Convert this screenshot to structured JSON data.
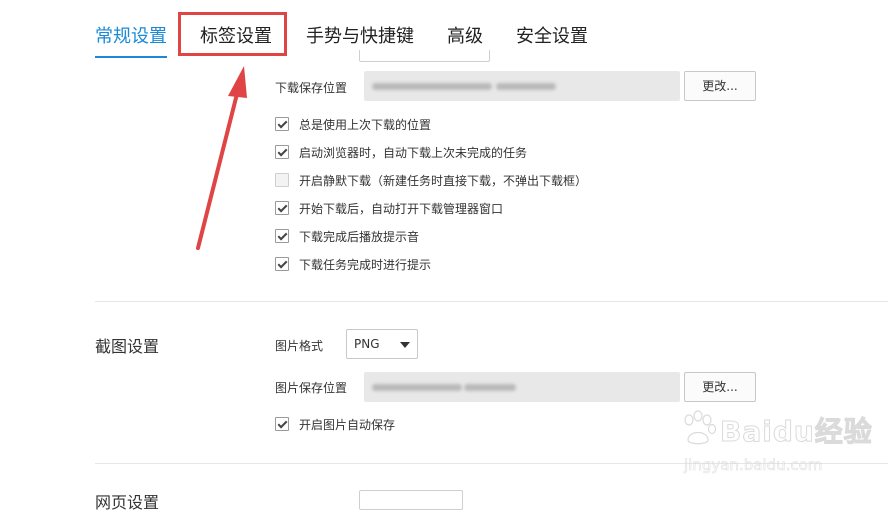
{
  "tabs": [
    {
      "label": "常规设置",
      "active": true
    },
    {
      "label": "标签设置",
      "active": false
    },
    {
      "label": "手势与快捷键",
      "active": false
    },
    {
      "label": "高级",
      "active": false
    },
    {
      "label": "安全设置",
      "active": false
    }
  ],
  "download": {
    "location_label": "下载保存位置",
    "change_button": "更改...",
    "options": [
      {
        "label": "总是使用上次下载的位置",
        "checked": true
      },
      {
        "label": "启动浏览器时，自动下载上次未完成的任务",
        "checked": true
      },
      {
        "label": "开启静默下载（新建任务时直接下载，不弹出下载框）",
        "checked": false
      },
      {
        "label": "开始下载后，自动打开下载管理器窗口",
        "checked": true
      },
      {
        "label": "下载完成后播放提示音",
        "checked": true
      },
      {
        "label": "下载任务完成时进行提示",
        "checked": true
      }
    ]
  },
  "screenshot": {
    "section_title": "截图设置",
    "format_label": "图片格式",
    "format_value": "PNG",
    "location_label": "图片保存位置",
    "change_button": "更改...",
    "auto_save": {
      "label": "开启图片自动保存",
      "checked": true
    }
  },
  "next_section_title": "网页设置",
  "watermark": {
    "brand": "Baidu经验",
    "url": "jingyan.baidu.com"
  },
  "colors": {
    "accent": "#1a8ad8",
    "highlight": "#e04545",
    "field_bg": "#e8e8e8"
  }
}
